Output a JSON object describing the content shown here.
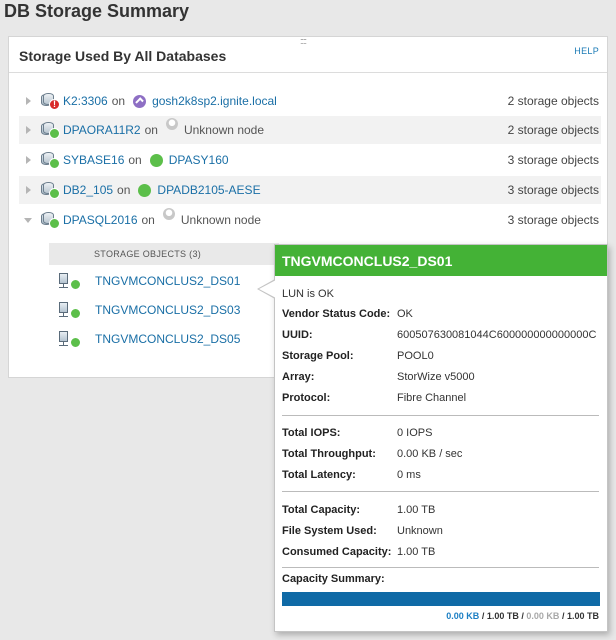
{
  "page_title": "DB Storage Summary",
  "panel": {
    "title": "Storage Used By All Databases",
    "handle": "::::",
    "help": "HELP"
  },
  "databases": [
    {
      "name": "K2:3306",
      "on": "on",
      "node": "gosh2k8sp2.ignite.local",
      "count": "2 storage objects",
      "status": "error",
      "node_icon": "purple-arrow-icon"
    },
    {
      "name": "DPAORA11R2",
      "on": "on",
      "node": "Unknown node",
      "count": "2 storage objects",
      "status": "ok",
      "node_icon": "unknown-node-icon"
    },
    {
      "name": "SYBASE16",
      "on": "on",
      "node": "DPASY160",
      "count": "3 storage objects",
      "status": "ok",
      "node_icon": "green-status-icon"
    },
    {
      "name": "DB2_105",
      "on": "on",
      "node": "DPADB2105-AESE",
      "count": "3 storage objects",
      "status": "ok",
      "node_icon": "green-status-icon"
    },
    {
      "name": "DPASQL2016",
      "on": "on",
      "node": "Unknown node",
      "count": "3 storage objects",
      "status": "ok",
      "node_icon": "unknown-node-icon"
    }
  ],
  "storage_objects": {
    "header": "STORAGE OBJECTS (3)",
    "items": [
      "TNGVMCONCLUS2_DS01",
      "TNGVMCONCLUS2_DS03",
      "TNGVMCONCLUS2_DS05"
    ]
  },
  "tooltip": {
    "title": "TNGVMCONCLUS2_DS01",
    "status_text": "LUN is OK",
    "details": [
      {
        "label": "Vendor Status Code:",
        "value": "OK"
      },
      {
        "label": "UUID:",
        "value": "600507630081044C600000000000000C"
      },
      {
        "label": "Storage Pool:",
        "value": "POOL0"
      },
      {
        "label": "Array:",
        "value": "StorWize v5000"
      },
      {
        "label": "Protocol:",
        "value": "Fibre Channel"
      }
    ],
    "performance": [
      {
        "label": "Total IOPS:",
        "value": "0 IOPS"
      },
      {
        "label": "Total Throughput:",
        "value": "0.00 KB / sec"
      },
      {
        "label": "Total Latency:",
        "value": "0 ms"
      }
    ],
    "capacity": [
      {
        "label": "Total Capacity:",
        "value": "1.00 TB"
      },
      {
        "label": "File System Used:",
        "value": "Unknown"
      },
      {
        "label": "Consumed Capacity:",
        "value": "1.00 TB"
      }
    ],
    "capacity_summary_label": "Capacity Summary:",
    "capacity_legend": {
      "used": "0.00 KB",
      "used_total": "1.00 TB",
      "free": "0.00 KB",
      "free_total": "1.00 TB",
      "separator": "/",
      "divider": "/"
    },
    "capacity_bar_fill": 1.0
  },
  "colors": {
    "header_green": "#44b236",
    "status_green": "#5cbf4a",
    "error_red": "#d82a2a",
    "link_blue": "#1a6fa6",
    "bar_blue": "#0f6aa6"
  }
}
